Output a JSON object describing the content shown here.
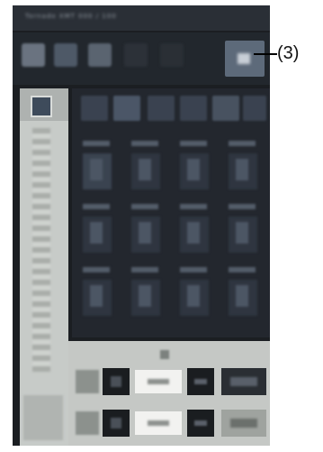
{
  "window": {
    "title": "Tornado XMT 000 / 100"
  },
  "toolbar": {
    "icons": [
      "select-tool-icon",
      "image-tool-icon",
      "light-tool-icon",
      "blank-tool-icon",
      "blank-tool-icon",
      "highlighted-tool-icon"
    ]
  },
  "left_column": {
    "button_icon": "mode-icon"
  },
  "grid": {
    "tabs": [
      "tab-a",
      "tab-b",
      "tab-c",
      "tab-d",
      "tab-e",
      "tab-f"
    ],
    "rows": 3,
    "cols": 4
  },
  "bottom_panel": {
    "rows": [
      {
        "value": "0000"
      },
      {
        "value": "0000"
      }
    ]
  },
  "callout": {
    "label": "(3)"
  }
}
